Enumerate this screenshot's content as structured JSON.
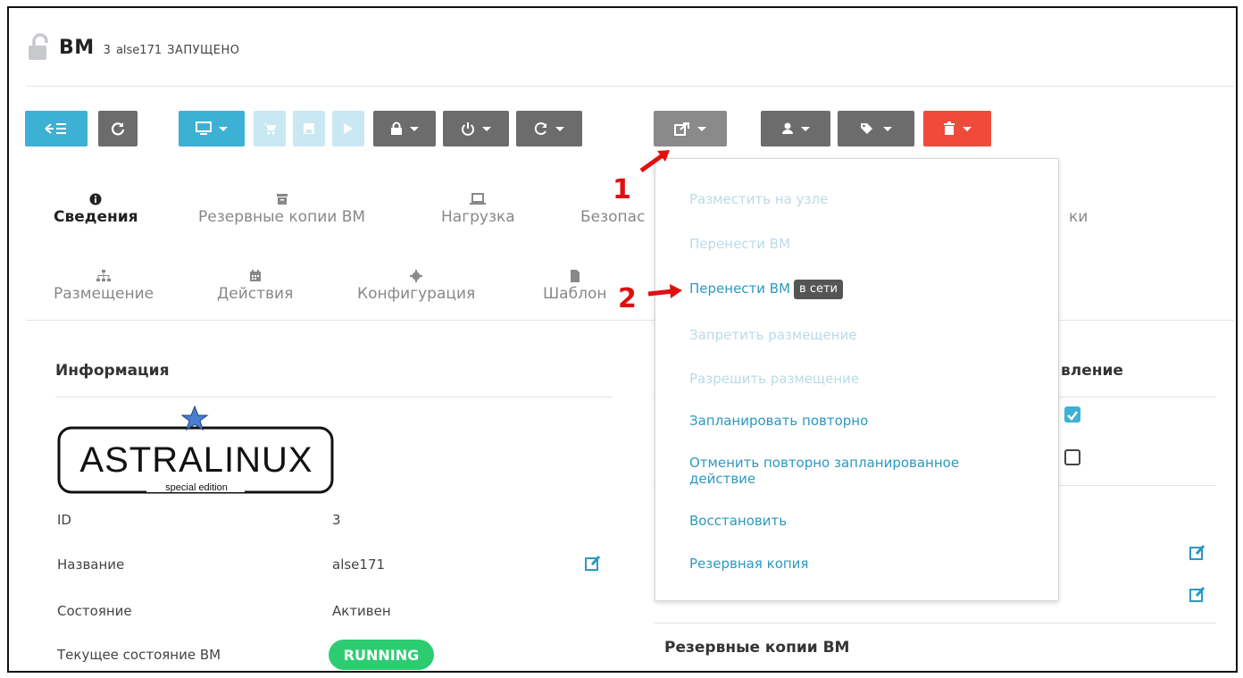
{
  "header": {
    "title": "ВМ",
    "id": "3",
    "name": "alse171",
    "state": "ЗАПУЩЕНО"
  },
  "tabs_row1": [
    {
      "label": "Сведения",
      "icon": "info-circle-icon"
    },
    {
      "label": "Резервные копии ВМ",
      "icon": "archive-icon"
    },
    {
      "label": "Нагрузка",
      "icon": "laptop-icon"
    },
    {
      "label": "Безопас",
      "icon": "lock-icon"
    },
    {
      "label": "ки",
      "icon": ""
    }
  ],
  "tabs_row2": [
    {
      "label": "Размещение",
      "icon": "sitemap-icon"
    },
    {
      "label": "Действия",
      "icon": "calendar-icon"
    },
    {
      "label": "Конфигурация",
      "icon": "cog-icon"
    },
    {
      "label": "Шаблон",
      "icon": "file-icon"
    }
  ],
  "info": {
    "title": "Информация",
    "logo_text": "ASTRALINUX",
    "logo_sub": "special edition",
    "rows": [
      {
        "label": "ID",
        "value": "3"
      },
      {
        "label": "Название",
        "value": "alse171"
      },
      {
        "label": "Состояние",
        "value": "Активен"
      },
      {
        "label": "Текущее состояние ВМ",
        "value": "RUNNING"
      }
    ]
  },
  "right_panel": {
    "title_fragment": "вление",
    "backups_title": "Резервные копии ВМ",
    "checkbox1": true,
    "checkbox2": false
  },
  "migrate_menu": {
    "items": [
      {
        "label": "Разместить на узле",
        "enabled": false
      },
      {
        "label": "Перенести ВМ",
        "enabled": false
      },
      {
        "label": "Перенести ВМ",
        "enabled": true,
        "tag": "в сети"
      },
      {
        "label": "Запретить размещение",
        "enabled": false
      },
      {
        "label": "Разрешить размещение",
        "enabled": false
      },
      {
        "label": "Запланировать повторно",
        "enabled": true
      },
      {
        "label": "Отменить повторно запланированное действие",
        "enabled": true
      },
      {
        "label": "Восстановить",
        "enabled": true
      },
      {
        "label": "Резервная копия",
        "enabled": true
      }
    ]
  },
  "annotations": {
    "marker1": "1",
    "marker2": "2",
    "color": "#e01010"
  },
  "colors": {
    "teal": "#3db1d4",
    "gray": "#6c6c6c",
    "red": "#ef4a3c",
    "running": "#2ecc71",
    "menu_link": "#2c98c0",
    "menu_disabled": "#b9dbe8"
  }
}
